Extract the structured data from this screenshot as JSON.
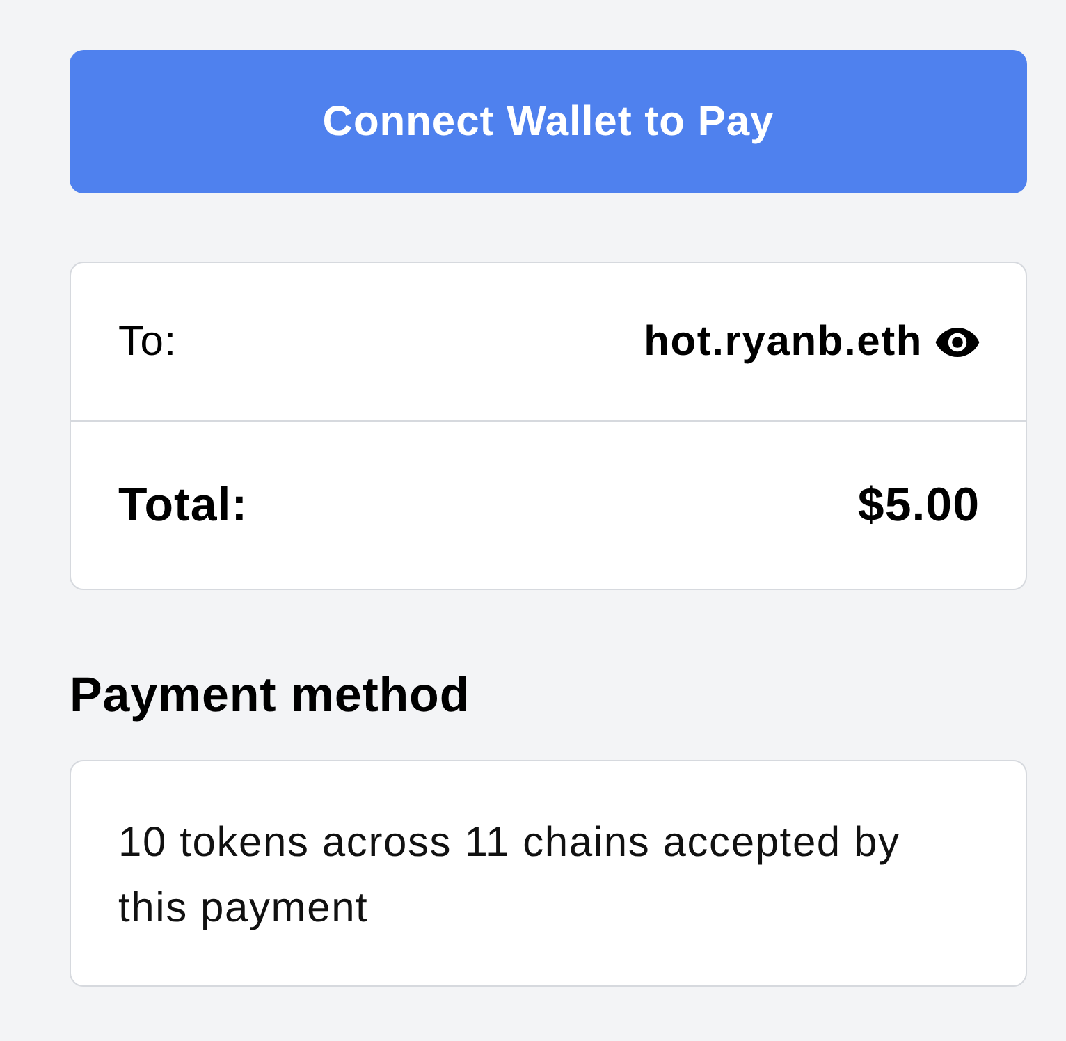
{
  "connect_button": {
    "label": "Connect Wallet to Pay"
  },
  "summary": {
    "rows": [
      {
        "kind": "recipient",
        "label": "To:",
        "value": "hot.ryanb.eth"
      },
      {
        "kind": "total",
        "label": "Total:",
        "value": "$5.00"
      }
    ]
  },
  "payment_method": {
    "heading": "Payment method",
    "description": "10 tokens across 11 chains accepted by this payment"
  }
}
